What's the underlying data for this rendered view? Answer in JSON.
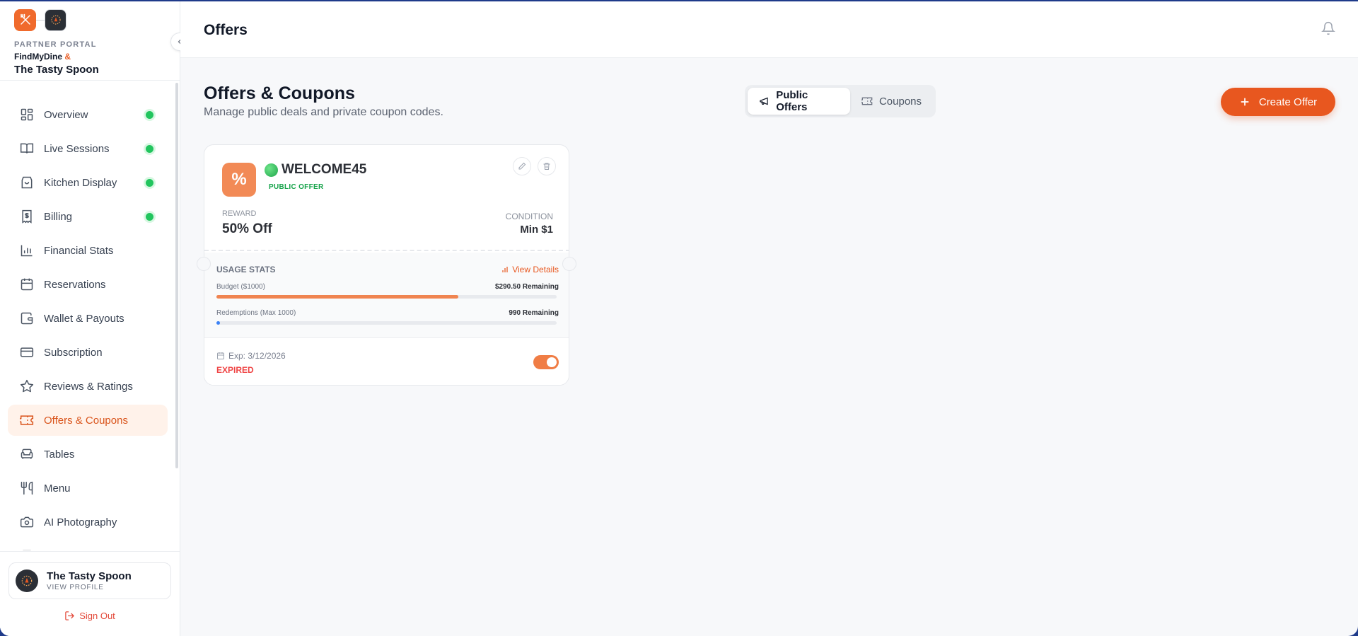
{
  "sidebar": {
    "portal_label": "PARTNER PORTAL",
    "brand": "FindMyDine",
    "amp": "&",
    "restaurant": "The Tasty Spoon",
    "items": [
      {
        "label": "Overview",
        "icon": "grid-icon",
        "status_dot": true
      },
      {
        "label": "Live Sessions",
        "icon": "book-icon",
        "status_dot": true
      },
      {
        "label": "Kitchen Display",
        "icon": "bag-icon",
        "status_dot": true
      },
      {
        "label": "Billing",
        "icon": "receipt-icon",
        "status_dot": true
      },
      {
        "label": "Financial Stats",
        "icon": "bar-chart-icon",
        "status_dot": false
      },
      {
        "label": "Reservations",
        "icon": "calendar-icon",
        "status_dot": false
      },
      {
        "label": "Wallet & Payouts",
        "icon": "wallet-icon",
        "status_dot": false
      },
      {
        "label": "Subscription",
        "icon": "credit-card-icon",
        "status_dot": false
      },
      {
        "label": "Reviews & Ratings",
        "icon": "star-icon",
        "status_dot": false
      },
      {
        "label": "Offers & Coupons",
        "icon": "ticket-icon",
        "status_dot": false,
        "active": true
      },
      {
        "label": "Tables",
        "icon": "armchair-icon",
        "status_dot": false
      },
      {
        "label": "Menu",
        "icon": "utensils-icon",
        "status_dot": false
      },
      {
        "label": "AI Photography",
        "icon": "camera-icon",
        "status_dot": false
      }
    ],
    "profile": {
      "name": "The Tasty Spoon",
      "sub": "VIEW PROFILE"
    },
    "signout": "Sign Out"
  },
  "header": {
    "title": "Offers"
  },
  "main": {
    "title": "Offers & Coupons",
    "subtitle": "Manage public deals and private coupon codes.",
    "tabs": [
      {
        "label": "Public Offers",
        "active": true
      },
      {
        "label": "Coupons",
        "active": false
      }
    ],
    "create_label": "Create Offer"
  },
  "offer": {
    "badge": "%",
    "code": "WELCOME45",
    "type": "PUBLIC OFFER",
    "reward_label": "REWARD",
    "reward_value": "50% Off",
    "condition_label": "CONDITION",
    "condition_value": "Min $1",
    "usage_label": "USAGE STATS",
    "view_details": "View Details",
    "budget_label": "Budget ($1000)",
    "budget_remaining": "$290.50 Remaining",
    "budget_used_fraction": 0.71,
    "redemptions_label": "Redemptions (Max 1000)",
    "redemptions_remaining": "990 Remaining",
    "redemptions_used_fraction": 0.01,
    "expiry": "Exp: 3/12/2026",
    "status": "EXPIRED",
    "toggle_on": true
  },
  "colors": {
    "accent": "#e8571f",
    "status_green": "#22c55e",
    "expired_red": "#ef4444",
    "redemption_blue": "#3b82f6"
  }
}
